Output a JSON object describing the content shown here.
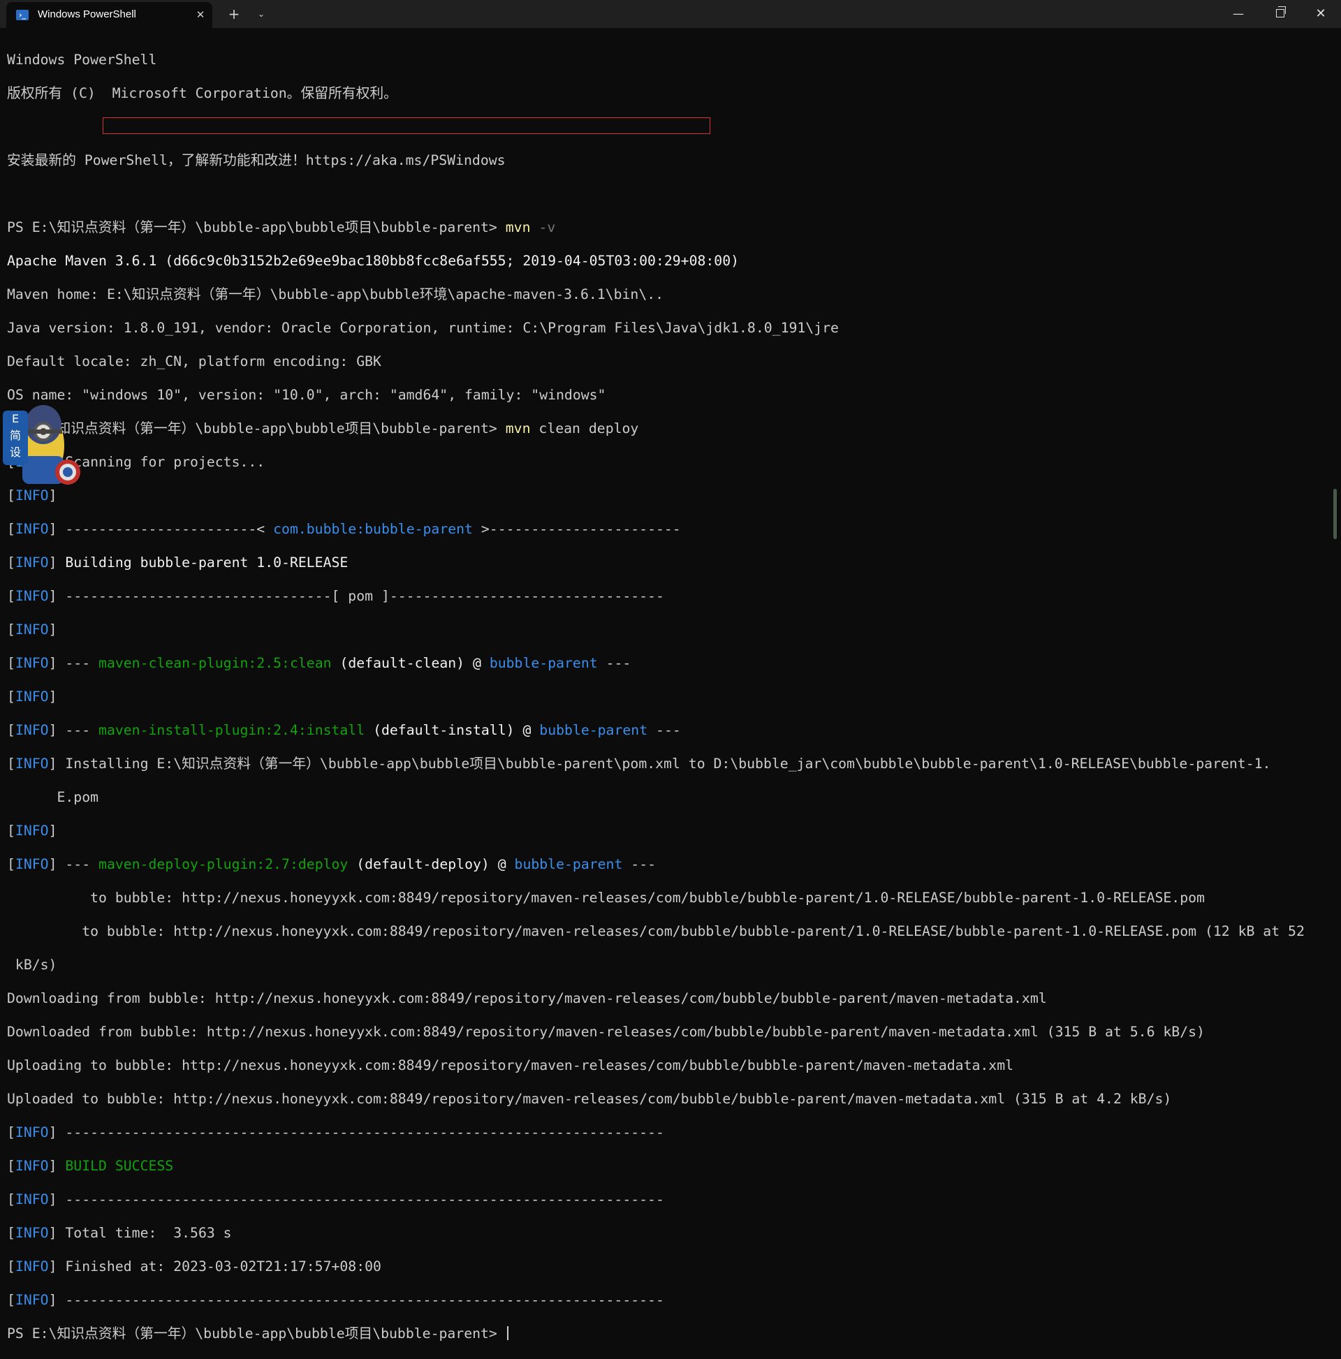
{
  "tab": {
    "title": "Windows PowerShell",
    "icon": "powershell-icon"
  },
  "window_controls": {
    "new_tab": "+",
    "dropdown": "⌄",
    "minimize": "—",
    "close": "✕"
  },
  "terminal": {
    "banner_title": "Windows PowerShell",
    "banner_copyright": "版权所有 (C)  Microsoft Corporation。保留所有权利。",
    "banner_update": "安装最新的 PowerShell，了解新功能和改进！https://aka.ms/PSWindows",
    "prompt": "PS E:\\知识点资料（第一年）\\bubble-app\\bubble项目\\bubble-parent>",
    "cmd1": "mvn",
    "cmd1_arg": "-v",
    "maven_version": "Apache Maven 3.6.1 (d66c9c0b3152b2e69ee9bac180bb8fcc8e6af555; 2019-04-05T03:00:29+08:00)",
    "maven_home_label": "Maven home:",
    "maven_home_value": "E:\\知识点资料（第一年）\\bubble-app\\bubble环境\\apache-maven-3.6.1\\bin\\..",
    "java_version": "Java version: 1.8.0_191, vendor: Oracle Corporation, runtime: C:\\Program Files\\Java\\jdk1.8.0_191\\jre",
    "default_locale": "Default locale: zh_CN, platform encoding: GBK",
    "os_name": "OS name: \"windows 10\", version: \"10.0\", arch: \"amd64\", family: \"windows\"",
    "cmd2": "mvn",
    "cmd2_args": "clean deploy",
    "info": "INFO",
    "scanning": "Scanning for projects...",
    "sep_left": "-----------------------<",
    "artifact": "com.bubble:bubble-parent",
    "sep_right": ">-----------------------",
    "building": "Building bubble-parent 1.0-RELEASE",
    "pom_line": "--------------------------------[ pom ]---------------------------------",
    "dashes3": "---",
    "clean_plugin": "maven-clean-plugin:2.5:clean",
    "clean_goal": "(default-clean) @",
    "project": "bubble-parent",
    "install_plugin": "maven-install-plugin:2.4:install",
    "install_goal": "(default-install) @",
    "installing": "Installing E:\\知识点资料（第一年）\\bubble-app\\bubble项目\\bubble-parent\\pom.xml to D:\\bubble_jar\\com\\bubble\\bubble-parent\\1.0-RELEASE\\bubble-parent-1.",
    "installing_wrap": "E.pom",
    "deploy_plugin": "maven-deploy-plugin:2.7:deploy",
    "deploy_goal": "(default-deploy) @",
    "uploading_pom": "to bubble: http://nexus.honeyyxk.com:8849/repository/maven-releases/com/bubble/bubble-parent/1.0-RELEASE/bubble-parent-1.0-RELEASE.pom",
    "uploaded_pom": "to bubble: http://nexus.honeyyxk.com:8849/repository/maven-releases/com/bubble/bubble-parent/1.0-RELEASE/bubble-parent-1.0-RELEASE.pom (12 kB at 52",
    "uploaded_pom_wrap": " kB/s)",
    "downloading_meta": "Downloading from bubble: http://nexus.honeyyxk.com:8849/repository/maven-releases/com/bubble/bubble-parent/maven-metadata.xml",
    "downloaded_meta": "Downloaded from bubble: http://nexus.honeyyxk.com:8849/repository/maven-releases/com/bubble/bubble-parent/maven-metadata.xml (315 B at 5.6 kB/s)",
    "uploading_meta": "Uploading to bubble: http://nexus.honeyyxk.com:8849/repository/maven-releases/com/bubble/bubble-parent/maven-metadata.xml",
    "uploaded_meta": "Uploaded to bubble: http://nexus.honeyyxk.com:8849/repository/maven-releases/com/bubble/bubble-parent/maven-metadata.xml (315 B at 4.2 kB/s)",
    "long_sep": "------------------------------------------------------------------------",
    "build_success": "BUILD SUCCESS",
    "total_time": "Total time:  3.563 s",
    "finished_at": "Finished at: 2023-03-02T21:17:57+08:00"
  },
  "overlay": {
    "badge_text": "E\n简\n设",
    "icon": "minion-mascot-icon"
  },
  "colors": {
    "background": "#0c0c0c",
    "text": "#cccccc",
    "info": "#3b8eea",
    "command": "#f9f1a5",
    "parameter": "#767676",
    "success": "#13a10e",
    "highlight_box": "#d13438"
  }
}
